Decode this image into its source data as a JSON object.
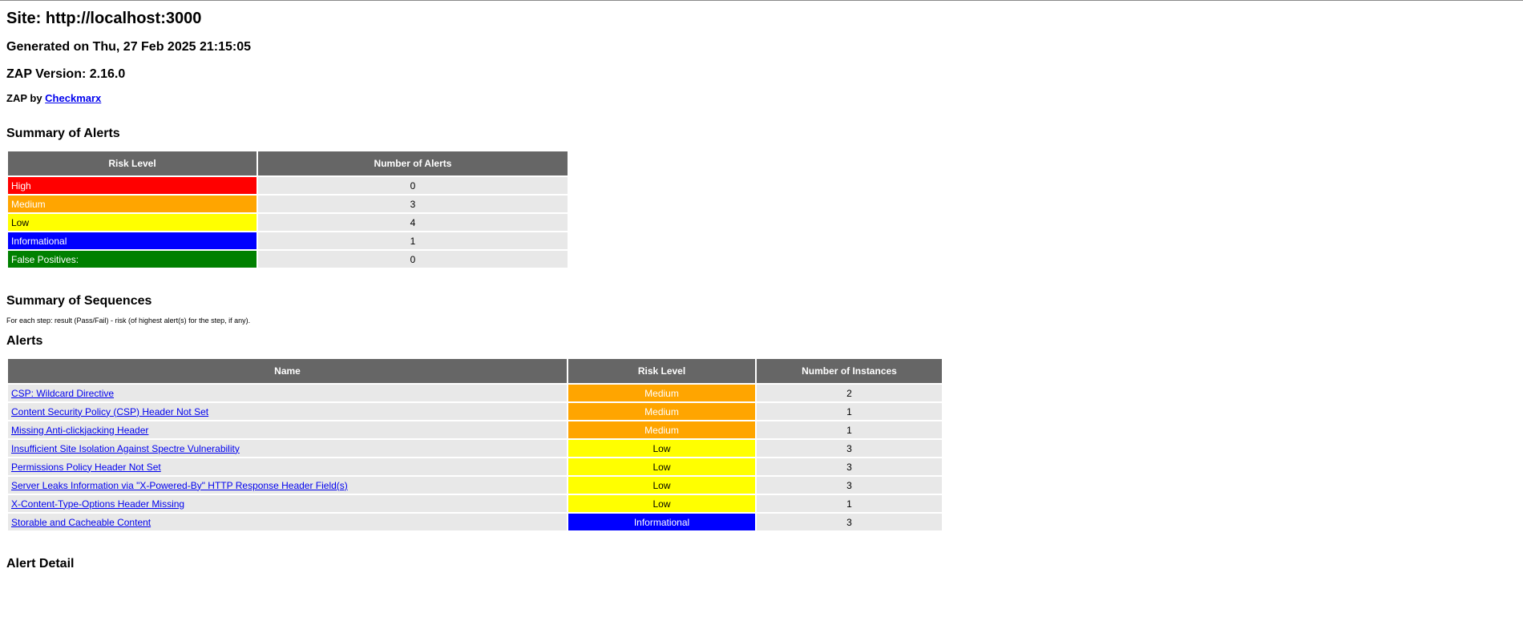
{
  "site_title": "Site: http://localhost:3000",
  "generated": "Generated on Thu, 27 Feb 2025 21:15:05",
  "zap_version": "ZAP Version: 2.16.0",
  "by_prefix": "ZAP by ",
  "by_link": "Checkmarx",
  "summary_alerts": {
    "heading": "Summary of Alerts",
    "col_risk": "Risk Level",
    "col_count": "Number of Alerts",
    "rows": [
      {
        "label": "High",
        "count": "0",
        "color": "#ff0000"
      },
      {
        "label": "Medium",
        "count": "3",
        "color": "#ffa500"
      },
      {
        "label": "Low",
        "count": "4",
        "color": "#ffff00"
      },
      {
        "label": "Informational",
        "count": "1",
        "color": "#0000ff"
      },
      {
        "label": "False Positives:",
        "count": "0",
        "color": "#008000"
      }
    ]
  },
  "summary_sequences": {
    "heading": "Summary of Sequences",
    "note": "For each step: result (Pass/Fail) - risk (of highest alert(s) for the step, if any)."
  },
  "alerts": {
    "heading": "Alerts",
    "col_name": "Name",
    "col_risk": "Risk Level",
    "col_instances": "Number of Instances",
    "rows": [
      {
        "name": "CSP: Wildcard Directive",
        "risk": "Medium",
        "instances": "2",
        "color": "#ffa500"
      },
      {
        "name": "Content Security Policy (CSP) Header Not Set",
        "risk": "Medium",
        "instances": "1",
        "color": "#ffa500"
      },
      {
        "name": "Missing Anti-clickjacking Header",
        "risk": "Medium",
        "instances": "1",
        "color": "#ffa500"
      },
      {
        "name": "Insufficient Site Isolation Against Spectre Vulnerability",
        "risk": "Low",
        "instances": "3",
        "color": "#ffff00"
      },
      {
        "name": "Permissions Policy Header Not Set",
        "risk": "Low",
        "instances": "3",
        "color": "#ffff00"
      },
      {
        "name": "Server Leaks Information via \"X-Powered-By\" HTTP Response Header Field(s)",
        "risk": "Low",
        "instances": "3",
        "color": "#ffff00"
      },
      {
        "name": "X-Content-Type-Options Header Missing",
        "risk": "Low",
        "instances": "1",
        "color": "#ffff00"
      },
      {
        "name": "Storable and Cacheable Content",
        "risk": "Informational",
        "instances": "3",
        "color": "#0000ff"
      }
    ]
  },
  "alert_detail": {
    "heading": "Alert Detail"
  }
}
